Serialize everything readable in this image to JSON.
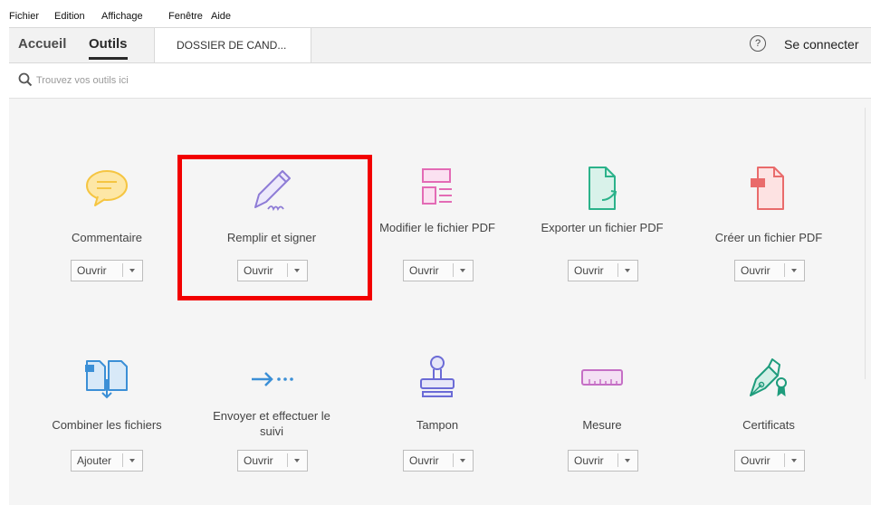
{
  "menu": [
    "Fichier",
    "Edition",
    "Affichage",
    "Fenêtre",
    "Aide"
  ],
  "tabs": {
    "home": "Accueil",
    "tools": "Outils",
    "document": "DOSSIER DE CAND..."
  },
  "header": {
    "help_icon": "question-circle-icon",
    "signin": "Se connecter"
  },
  "search": {
    "placeholder": "Trouvez vos outils ici"
  },
  "tools": [
    {
      "label": "Commentaire",
      "button": "Ouvrir",
      "icon": "comment-icon",
      "color": "#f5c542"
    },
    {
      "label": "Remplir et signer",
      "button": "Ouvrir",
      "icon": "fill-sign-icon",
      "color": "#8e7cd6"
    },
    {
      "label": "Modifier le fichier PDF",
      "button": "Ouvrir",
      "icon": "edit-pdf-icon",
      "color": "#e36bb5"
    },
    {
      "label": "Exporter un fichier PDF",
      "button": "Ouvrir",
      "icon": "export-pdf-icon",
      "color": "#2bb28a"
    },
    {
      "label": "Créer un fichier PDF",
      "button": "Ouvrir",
      "icon": "create-pdf-icon",
      "color": "#e96b6b"
    },
    {
      "label": "Combiner les fichiers",
      "button": "Ajouter",
      "icon": "combine-icon",
      "color": "#3b8fd6"
    },
    {
      "label": "Envoyer et effectuer le suivi",
      "button": "Ouvrir",
      "icon": "send-track-icon",
      "color": "#3b8fd6"
    },
    {
      "label": "Tampon",
      "button": "Ouvrir",
      "icon": "stamp-icon",
      "color": "#6b6bd6"
    },
    {
      "label": "Mesure",
      "button": "Ouvrir",
      "icon": "measure-icon",
      "color": "#c56fc5"
    },
    {
      "label": "Certificats",
      "button": "Ouvrir",
      "icon": "certificate-icon",
      "color": "#1e9c7c"
    }
  ],
  "highlight_color": "#f20000"
}
